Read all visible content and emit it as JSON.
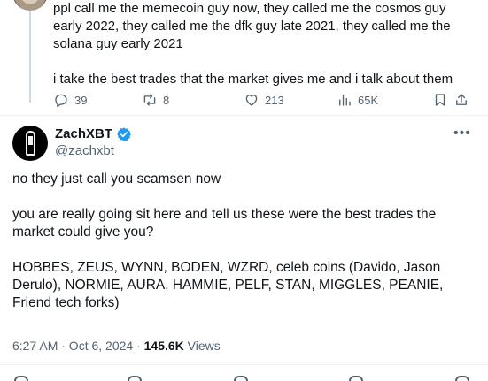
{
  "parent_tweet": {
    "text_line_1": "ppl call me the memecoin guy now, they called me the cosmos guy early 2022, they called me the dfk guy late 2021, they called me the solana guy early 2021",
    "text_line_2": "i take the best trades that the market gives me and i talk about them",
    "actions": {
      "reply_count": "39",
      "retweet_count": "8",
      "like_count": "213",
      "view_count": "65K"
    }
  },
  "main_tweet": {
    "author_name": "ZachXBT",
    "author_handle": "@zachxbt",
    "paragraph_1": "no they just call you scamsen now",
    "paragraph_2": "you are really going sit here and tell us these were the best trades the market could give you?",
    "paragraph_3": "HOBBES, ZEUS, WYNN, BODEN, WZRD, celeb coins (Davido, Jason Derulo), NORMIE, AURA, HAMMIE, PELF, STAN, MIGGLES, PEANIE, Friend tech forks)",
    "timestamp": "6:27 AM · Oct 6, 2024 · ",
    "views_count": "145.6K",
    "views_label": " Views"
  },
  "colors": {
    "verified_badge": "#1d9bf0",
    "secondary_text": "#536471",
    "primary_text": "#0f1419"
  }
}
